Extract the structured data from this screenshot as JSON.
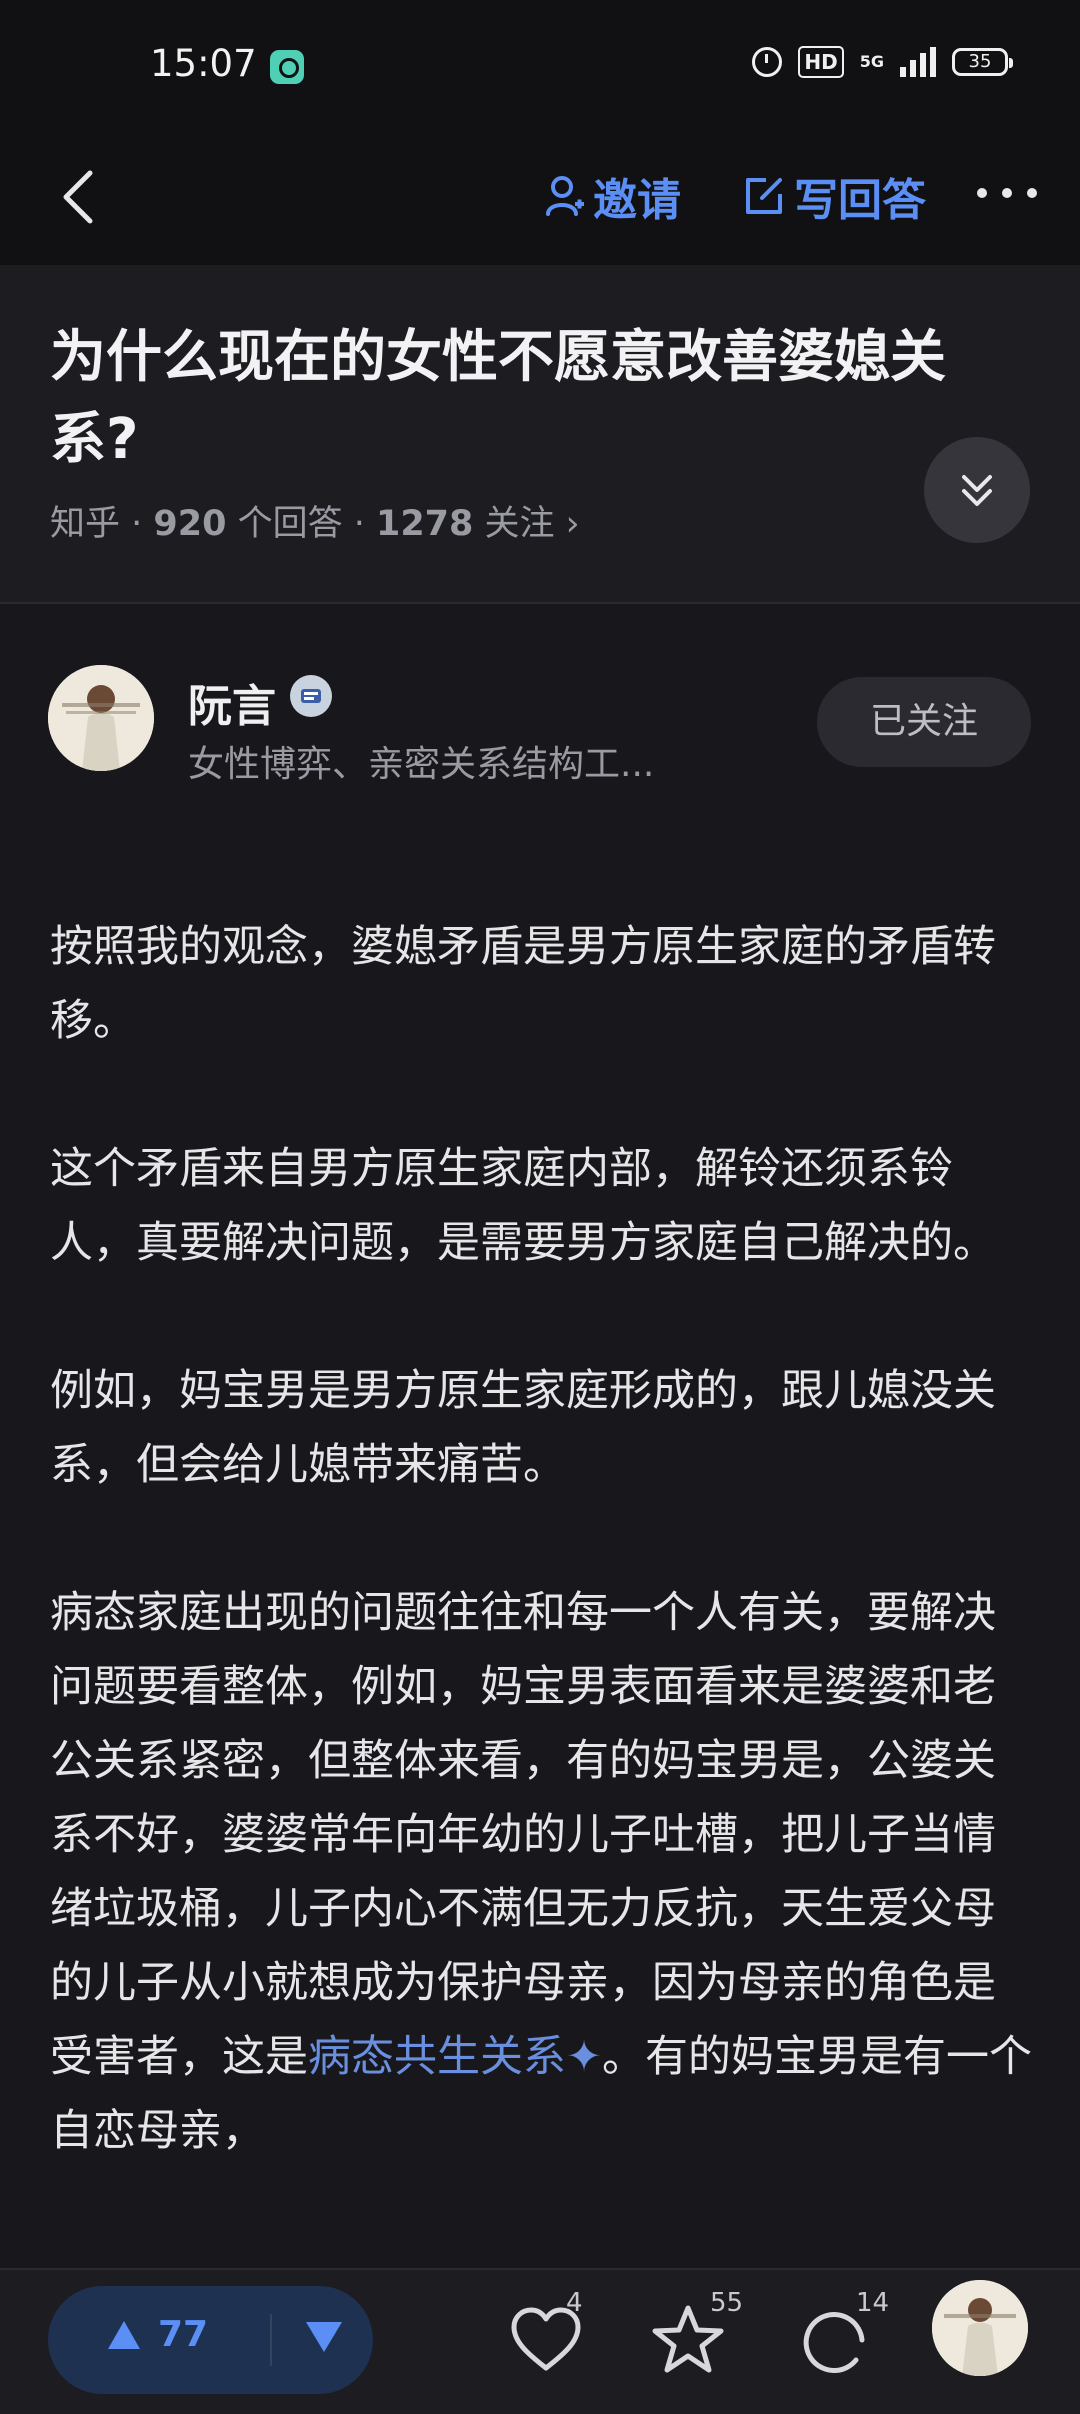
{
  "status": {
    "time": "15:07",
    "hd": "HD",
    "network": "5G",
    "battery": "35"
  },
  "nav": {
    "invite_label": "邀请",
    "write_answer_label": "写回答"
  },
  "question": {
    "title": "为什么现在的女性不愿意改善婆媳关系?",
    "source": "知乎 · ",
    "answers_count": "920",
    "answers_label": " 个回答 · ",
    "follow_count": "1278",
    "follow_label": " 关注 ›"
  },
  "author": {
    "name": "阮言",
    "bio": "女性博弈、亲密关系结构工...",
    "follow_button": "已关注"
  },
  "article": {
    "p1": "按照我的观念，婆媳矛盾是男方原生家庭的矛盾转移。",
    "p2": "这个矛盾来自男方原生家庭内部，解铃还须系铃人，真要解决问题，是需要男方家庭自己解决的。",
    "p3": "例如，妈宝男是男方原生家庭形成的，跟儿媳没关系，但会给儿媳带来痛苦。",
    "p4_before": "病态家庭出现的问题往往和每一个人有关，要解决问题要看整体，例如，妈宝男表面看来是婆婆和老公关系紧密，但整体来看，有的妈宝男是，公婆关系不好，婆婆常年向年幼的儿子吐槽，把儿子当情绪垃圾桶，儿子内心不满但无力反抗，天生爱父母的儿子从小就想成为保护母亲，因为母亲的角色是受害者，这是",
    "p4_link": "病态共生关系✦",
    "p4_after": "。有的妈宝男是有一个自恋母亲，"
  },
  "bottom": {
    "upvotes": "77",
    "likes": "4",
    "favorites": "55",
    "comments": "14"
  },
  "colors": {
    "accent": "#5b8ff5",
    "background": "#18181c",
    "link": "#6b8fdf"
  }
}
